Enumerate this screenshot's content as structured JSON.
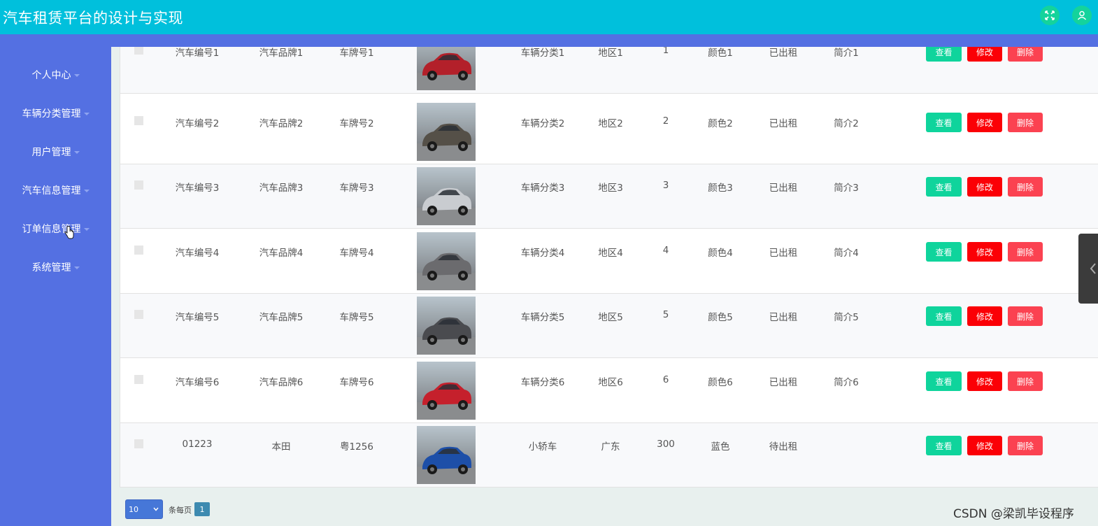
{
  "app": {
    "title": "汽车租赁平台的设计与实现"
  },
  "header_icons": [
    {
      "name": "fullscreen-icon",
      "color": "#14d39c"
    },
    {
      "name": "user-icon",
      "color": "#14d39c"
    }
  ],
  "sidebar": {
    "items": [
      {
        "label": "个人中心"
      },
      {
        "label": "车辆分类管理"
      },
      {
        "label": "用户管理"
      },
      {
        "label": "汽车信息管理"
      },
      {
        "label": "订单信息管理"
      },
      {
        "label": "系统管理"
      }
    ]
  },
  "table": {
    "rows": [
      {
        "car_no": "汽车编号1",
        "brand": "汽车品牌1",
        "plate": "车牌号1",
        "category": "车辆分类1",
        "region": "地区1",
        "price": "1",
        "color": "颜色1",
        "status": "已出租",
        "intro": "简介1"
      },
      {
        "car_no": "汽车编号2",
        "brand": "汽车品牌2",
        "plate": "车牌号2",
        "category": "车辆分类2",
        "region": "地区2",
        "price": "2",
        "color": "颜色2",
        "status": "已出租",
        "intro": "简介2"
      },
      {
        "car_no": "汽车编号3",
        "brand": "汽车品牌3",
        "plate": "车牌号3",
        "category": "车辆分类3",
        "region": "地区3",
        "price": "3",
        "color": "颜色3",
        "status": "已出租",
        "intro": "简介3"
      },
      {
        "car_no": "汽车编号4",
        "brand": "汽车品牌4",
        "plate": "车牌号4",
        "category": "车辆分类4",
        "region": "地区4",
        "price": "4",
        "color": "颜色4",
        "status": "已出租",
        "intro": "简介4"
      },
      {
        "car_no": "汽车编号5",
        "brand": "汽车品牌5",
        "plate": "车牌号5",
        "category": "车辆分类5",
        "region": "地区5",
        "price": "5",
        "color": "颜色5",
        "status": "已出租",
        "intro": "简介5"
      },
      {
        "car_no": "汽车编号6",
        "brand": "汽车品牌6",
        "plate": "车牌号6",
        "category": "车辆分类6",
        "region": "地区6",
        "price": "6",
        "color": "颜色6",
        "status": "已出租",
        "intro": "简介6"
      },
      {
        "car_no": "01223",
        "brand": "本田",
        "plate": "粤1256",
        "category": "小轿车",
        "region": "广东",
        "price": "300",
        "color": "蓝色",
        "status": "待出租",
        "intro": ""
      }
    ],
    "actions": {
      "view": "查看",
      "edit": "修改",
      "delete": "删除"
    },
    "car_colors": [
      "#b3202a",
      "#555048",
      "#c9ccd0",
      "#6b6b6e",
      "#4a4b4f",
      "#c5202c",
      "#1d4fa8"
    ]
  },
  "pagination": {
    "page_size": "10",
    "page_size_label": "条每页",
    "current_page": "1"
  },
  "watermark": "CSDN @梁凯毕设程序",
  "colors": {
    "topbar": "#00c0dc",
    "sidebar": "#5470e2",
    "view_button": "#0fd49c",
    "edit_button": "#fb0006",
    "delete_button": "#fb4251"
  }
}
